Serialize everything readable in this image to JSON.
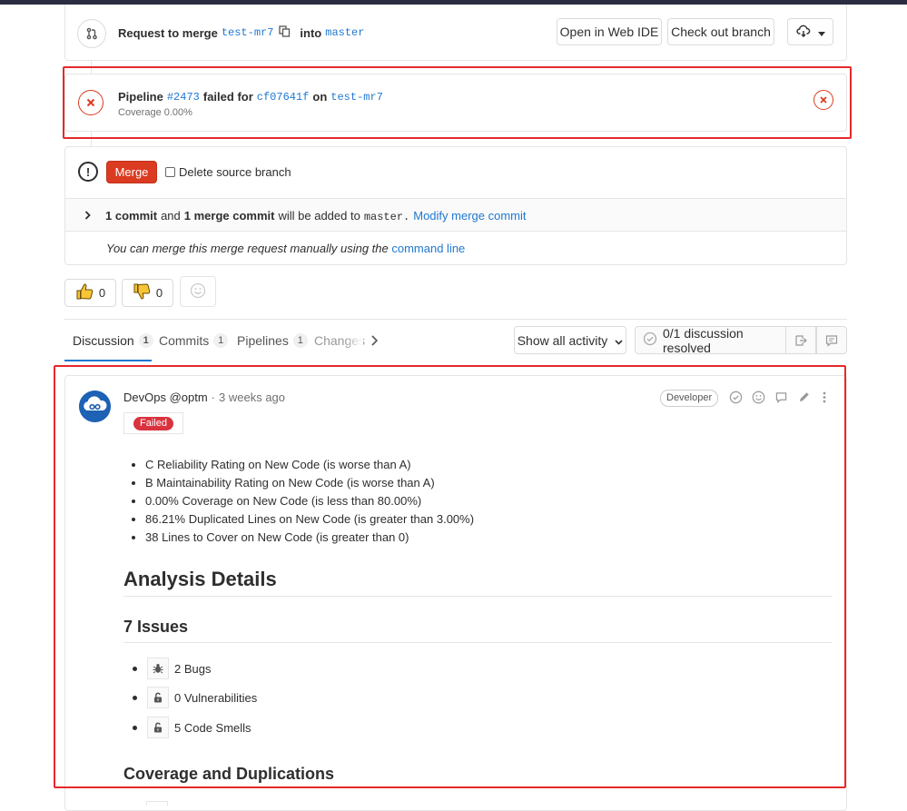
{
  "widget": {
    "request_to_merge": "Request to merge",
    "source_branch": "test-mr7",
    "into": "into",
    "target_branch": "master",
    "open_web_ide": "Open in Web IDE",
    "check_out_branch": "Check out branch"
  },
  "pipeline": {
    "label": "Pipeline",
    "id": "#2473",
    "failed_for": "failed for",
    "commit": "cf07641f",
    "on": "on",
    "branch": "test-mr7",
    "coverage": "Coverage 0.00%"
  },
  "merge": {
    "button": "Merge",
    "delete_source": "Delete source branch",
    "commit_count": "1 commit",
    "and": "and",
    "merge_commit": "1 merge commit",
    "will_be_added": "will be added to",
    "target": "master",
    "modify": "Modify merge commit",
    "manual_text": "You can merge this merge request manually using the",
    "command_line": "command line"
  },
  "awards": {
    "thumbs_up_count": "0",
    "thumbs_down_count": "0"
  },
  "tabs": [
    {
      "label": "Discussion",
      "count": "1"
    },
    {
      "label": "Commits",
      "count": "1"
    },
    {
      "label": "Pipelines",
      "count": "1"
    },
    {
      "label": "Changes"
    }
  ],
  "activity": {
    "filter": "Show all activity",
    "discussions": "0/1 discussion resolved"
  },
  "note": {
    "author": "DevOps @optm",
    "separator": "·",
    "time": "3 weeks ago",
    "role": "Developer",
    "status": "Failed",
    "conditions": [
      "C Reliability Rating on New Code (is worse than A)",
      "B Maintainability Rating on New Code (is worse than A)",
      "0.00% Coverage on New Code (is less than 80.00%)",
      "86.21% Duplicated Lines on New Code (is greater than 3.00%)",
      "38 Lines to Cover on New Code (is greater than 0)"
    ],
    "analysis_title": "Analysis Details",
    "issues_title": "7 Issues",
    "issues": [
      {
        "icon": "bug-icon",
        "text": "2 Bugs"
      },
      {
        "icon": "unlock-icon",
        "text": "0 Vulnerabilities"
      },
      {
        "icon": "unlock-icon",
        "text": "5 Code Smells"
      }
    ],
    "coverage_title": "Coverage and Duplications"
  },
  "colors": {
    "danger": "#db3b21",
    "link": "#1f78d1",
    "highlight": "#e52a2a"
  }
}
